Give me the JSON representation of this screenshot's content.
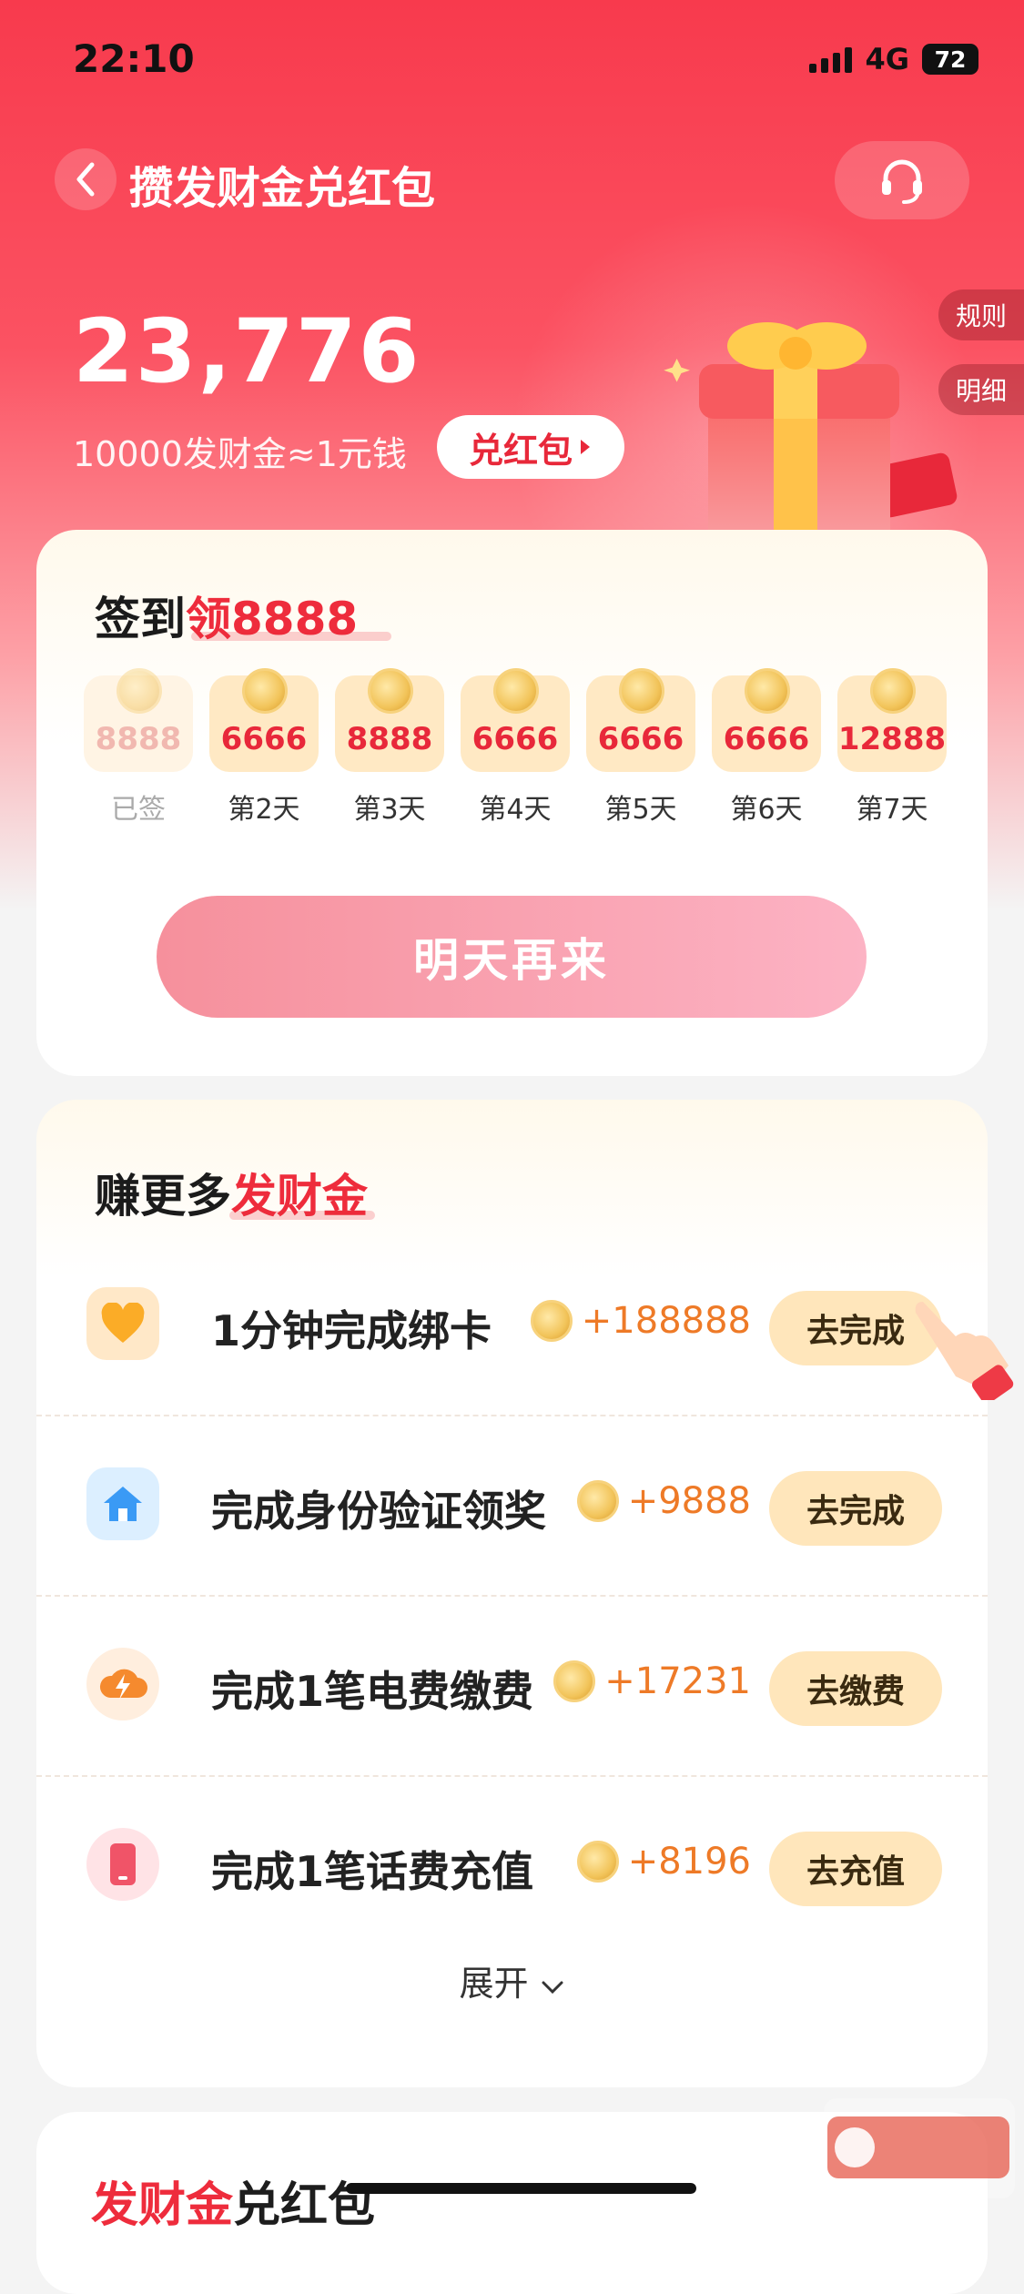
{
  "status": {
    "time": "22:10",
    "network": "4G",
    "battery": "72"
  },
  "nav": {
    "title": "攒发财金兑红包"
  },
  "side": {
    "rules": "规则",
    "detail": "明细"
  },
  "account": {
    "balance": "23,776",
    "rate": "10000发财金≈1元钱",
    "redeem_label": "兑红包"
  },
  "sign_in": {
    "title_prefix": "签到",
    "title_highlight": "领8888",
    "days": [
      {
        "amount": "8888",
        "label": "已签",
        "done": true
      },
      {
        "amount": "6666",
        "label": "第2天",
        "done": false
      },
      {
        "amount": "8888",
        "label": "第3天",
        "done": false
      },
      {
        "amount": "6666",
        "label": "第4天",
        "done": false
      },
      {
        "amount": "6666",
        "label": "第5天",
        "done": false
      },
      {
        "amount": "6666",
        "label": "第6天",
        "done": false
      },
      {
        "amount": "12888",
        "label": "第7天",
        "done": false
      }
    ],
    "button": "明天再来"
  },
  "earn": {
    "title_prefix": "赚更多",
    "title_highlight": "发财金",
    "tasks": [
      {
        "name": "1分钟完成绑卡",
        "reward": "+188888",
        "button": "去完成",
        "icon": "heart-icon"
      },
      {
        "name": "完成身份验证领奖",
        "reward": "+9888",
        "button": "去完成",
        "icon": "home-icon"
      },
      {
        "name": "完成1笔电费缴费",
        "reward": "+17231",
        "button": "去缴费",
        "icon": "lightning-icon"
      },
      {
        "name": "完成1笔话费充值",
        "reward": "+8196",
        "button": "去充值",
        "icon": "phone-icon"
      }
    ],
    "expand": "展开"
  },
  "redeem_section": {
    "title_highlight": "发财金",
    "title_suffix": "兑红包"
  },
  "colors": {
    "primary_red": "#f83a4d",
    "accent_orange": "#ee7a27",
    "button_cream": "#ffe6bb"
  }
}
